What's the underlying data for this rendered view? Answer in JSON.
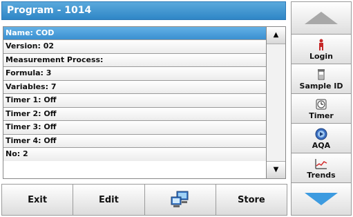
{
  "title": "Program - 1014",
  "rows": [
    "Name: COD",
    "Version: 02",
    "Measurement Process:",
    "Formula: 3",
    "Variables: 7",
    "Timer 1: Off",
    "Timer 2: Off",
    "Timer 3: Off",
    "Timer 4: Off",
    "No: 2"
  ],
  "selected_row": "Name: COD",
  "scroll": {
    "up_icon": "triangle-up-icon",
    "down_icon": "triangle-down-icon"
  },
  "bottom_buttons": {
    "exit": "Exit",
    "edit": "Edit",
    "transfer_icon": "computer-transfer-icon",
    "store": "Store"
  },
  "side": {
    "nav_up_icon": "chevron-up-icon",
    "login": "Login",
    "sample_id": "Sample ID",
    "timer": "Timer",
    "aqa": "AQA",
    "trends": "Trends",
    "nav_down_icon": "chevron-down-icon"
  },
  "colors": {
    "accent": "#3a8fd0",
    "nav_down": "#3d9be0",
    "nav_up": "#a8a8a8"
  }
}
